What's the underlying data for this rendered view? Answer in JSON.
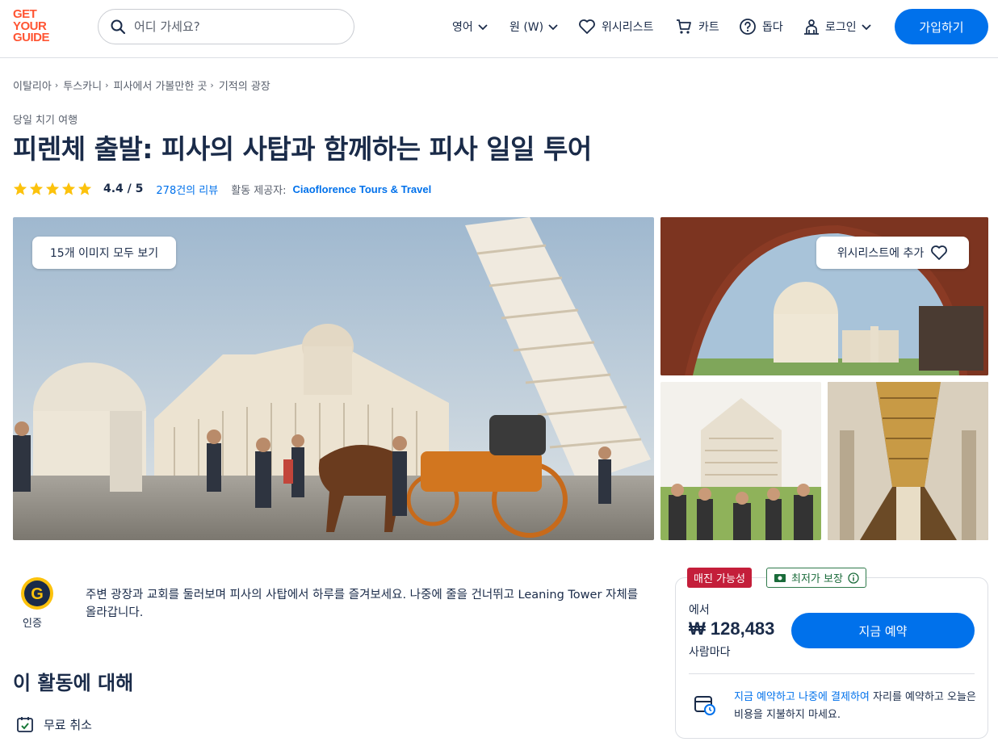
{
  "header": {
    "logo": [
      "GET",
      "YOUR",
      "GUIDE"
    ],
    "search_placeholder": "어디 가세요?",
    "language": "영어",
    "currency": "원 (W)",
    "wishlist": "위시리스트",
    "cart": "카트",
    "help": "돕다",
    "login": "로그인",
    "signup": "가입하기"
  },
  "breadcrumb": [
    "이탈리아",
    "투스카니",
    "피사에서 가볼만한 곳",
    "기적의 광장"
  ],
  "activity": {
    "category": "당일 치기 여행",
    "title": "피렌체 출발: 피사의 사탑과 함께하는 피사 일일 투어",
    "rating": "4.4 / 5",
    "rating_value": 4.4,
    "rating_max": 5,
    "reviews": "278건의 리뷰",
    "provider_label": "활동 제공자:",
    "provider": "Ciaoflorence Tours & Travel"
  },
  "gallery": {
    "view_all": "15개 이미지 모두 보기",
    "add_wishlist": "위시리스트에 추가"
  },
  "badge": {
    "letter": "G",
    "label": "인증"
  },
  "summary": "주변 광장과 교회를 둘러보며 피사의 사탑에서 하루를 즐겨보세요. 나중에 줄을 건너뛰고 Leaning Tower 자체를 올라갑니다.",
  "about": {
    "title": "이 활동에 대해",
    "free_cancel": "무료 취소"
  },
  "booking": {
    "tag_sellout": "매진 가능성",
    "tag_best_price": "최저가 보장",
    "from": "에서",
    "price": "₩ 128,483",
    "per": "사람마다",
    "book_now": "지금 예약",
    "rnpl_link": "지금 예약하고 나중에 결제하여",
    "rnpl_rest": " 자리를 예약하고 오늘은 비용을 지불하지 마세요."
  },
  "colors": {
    "brand_orange": "#ff5533",
    "primary_blue": "#0071eb",
    "star_yellow": "#fcc20c",
    "tag_red": "#c41e3a",
    "tag_green": "#1a6b3a"
  }
}
